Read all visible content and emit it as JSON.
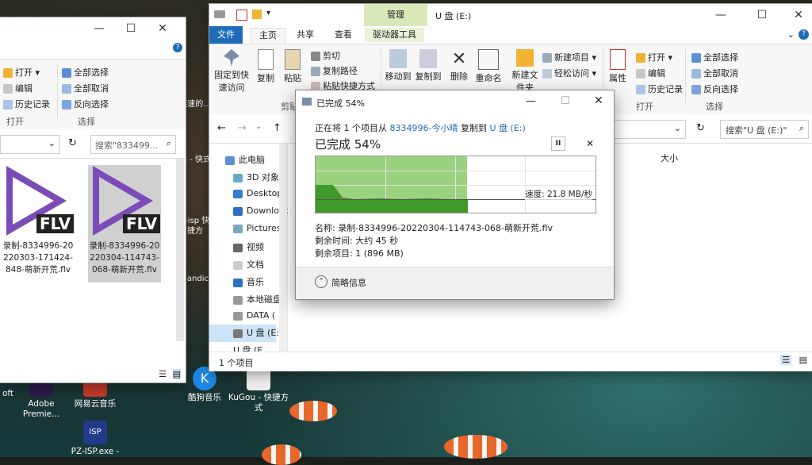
{
  "desktop": {
    "icons": [
      {
        "label": "oft"
      },
      {
        "label": "Adobe Premie..."
      },
      {
        "label": "网易云音乐"
      },
      {
        "label": "酷狗音乐"
      },
      {
        "label": "KuGou - 快捷方式"
      },
      {
        "label": "PZ-ISP.exe -"
      }
    ],
    "side_labels": [
      "奕速的...",
      "乐 - 快式",
      "c-isp 快捷方",
      "Bandic"
    ]
  },
  "left_window": {
    "ribbon": {
      "open": "打开",
      "edit": "编辑",
      "history": "历史记录",
      "group_open": "打开",
      "select_all": "全部选择",
      "select_none": "全部取消",
      "invert": "反向选择",
      "group_select": "选择"
    },
    "search_placeholder": "搜索\"833499...",
    "files": [
      {
        "badge": "FLV",
        "name": "录制-8334996-20220303-171424-848-萌新开荒.flv"
      },
      {
        "badge": "FLV",
        "name": "录制-8334996-20220304-114743-068-萌新开荒.flv"
      }
    ]
  },
  "main_window": {
    "title": "U 盘 (E:)",
    "context_tab_group": "管理",
    "tabs": [
      "文件",
      "主页",
      "共享",
      "查看",
      "驱动器工具"
    ],
    "ribbon": {
      "pin": "固定到快速访问",
      "copy": "复制",
      "paste": "粘贴",
      "cut": "剪切",
      "copy_path": "复制路径",
      "paste_shortcut": "粘贴快捷方式",
      "group_clipboard": "剪贴板",
      "move_to": "移动到",
      "copy_to": "复制到",
      "delete": "删除",
      "rename": "重命名",
      "new_folder": "新建文件夹",
      "new_item": "新建项目",
      "easy_access": "轻松访问",
      "properties": "属性",
      "open": "打开",
      "edit": "编辑",
      "history": "历史记录",
      "group_open": "打开",
      "select_all": "全部选择",
      "select_none": "全部取消",
      "invert": "反向选择",
      "group_select": "选择"
    },
    "search_placeholder": "搜索\"U 盘 (E:)\"",
    "column_size": "大小",
    "nav": [
      "此电脑",
      "3D 对象",
      "Desktop",
      "Downloads",
      "Pictures",
      "视频",
      "文档",
      "音乐",
      "本地磁盘",
      "DATA (",
      "U 盘 (E:",
      "U 盘 (E"
    ],
    "status": "1 个项目"
  },
  "dialog": {
    "title": "已完成 54%",
    "line1_prefix": "正在将 1 个项目从",
    "source": "8334996-今小晴",
    "line1_mid": "复制到",
    "dest": "U 盘 (E:)",
    "heading": "已完成 54%",
    "percent": 54,
    "speed": "速度: 21.8 MB/秒",
    "name_line": "名称: 录制-8334996-20220304-114743-068-萌新开荒.flv",
    "time_line": "剩余时间: 大约 45 秒",
    "items_line": "剩余项目: 1 (896 MB)",
    "less_info": "简略信息",
    "pause_glyph": "II",
    "close_glyph": "✕"
  },
  "colors": {
    "accent": "#1e6bb8",
    "graph_fill": "#9bd27f",
    "graph_area": "#3f9a2a",
    "flv_purple": "#7b4bb8"
  }
}
